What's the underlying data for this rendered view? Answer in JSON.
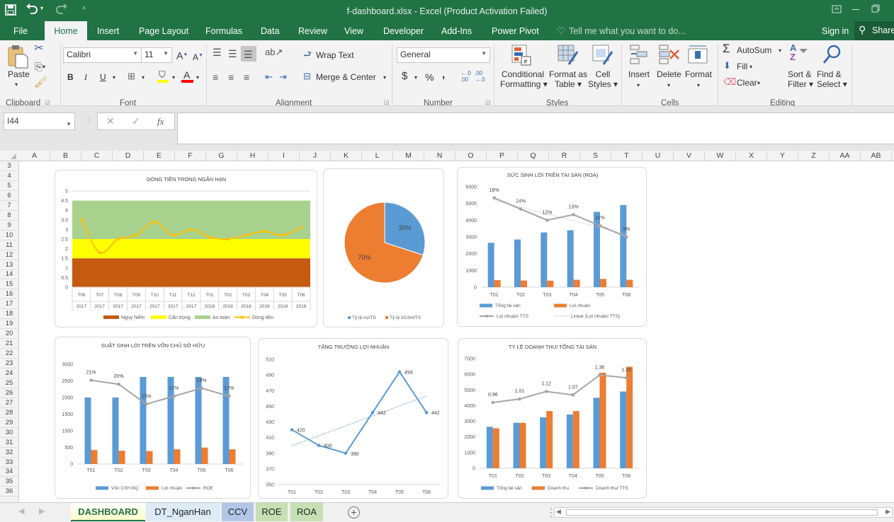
{
  "window": {
    "title": "f-dashboard.xlsx - Excel (Product Activation Failed)"
  },
  "menu_tabs": [
    "File",
    "Home",
    "Insert",
    "Page Layout",
    "Formulas",
    "Data",
    "Review",
    "View",
    "Developer",
    "Add-Ins",
    "Power Pivot"
  ],
  "active_tab": "Home",
  "tell_me": "Tell me what you want to do...",
  "sign_in": "Sign in",
  "share": "Share",
  "ribbon": {
    "clipboard": {
      "label": "Clipboard",
      "paste": "Paste"
    },
    "font": {
      "label": "Font",
      "name": "Calibri",
      "size": "11",
      "bold": "B",
      "italic": "I",
      "underline": "U",
      "fill_color": "#ffff00",
      "font_color": "#ff0000"
    },
    "alignment": {
      "label": "Alignment",
      "wrap": "Wrap Text",
      "merge": "Merge & Center"
    },
    "number": {
      "label": "Number",
      "format": "General",
      "currency": "$",
      "percent": "%",
      "comma": ","
    },
    "styles": {
      "label": "Styles",
      "conditional": [
        "Conditional",
        "Formatting"
      ],
      "format_table": [
        "Format as",
        "Table"
      ],
      "cell_styles": [
        "Cell",
        "Styles"
      ]
    },
    "cells": {
      "label": "Cells",
      "insert": "Insert",
      "delete": "Delete",
      "format": "Format"
    },
    "editing": {
      "label": "Editing",
      "autosum": "AutoSum",
      "fill": "Fill",
      "clear": "Clear",
      "sort": [
        "Sort &",
        "Filter"
      ],
      "find": [
        "Find &",
        "Select"
      ]
    }
  },
  "formula_bar": {
    "name_box": "I44",
    "formula": "",
    "fx": "fx"
  },
  "columns": [
    "A",
    "B",
    "C",
    "D",
    "E",
    "F",
    "G",
    "H",
    "I",
    "J",
    "K",
    "L",
    "M",
    "N",
    "O",
    "P",
    "Q",
    "R",
    "S",
    "T",
    "U",
    "V",
    "W",
    "X",
    "Y",
    "Z",
    "AA",
    "AB"
  ],
  "rows": [
    "3",
    "4",
    "5",
    "6",
    "7",
    "8",
    "9",
    "10",
    "11",
    "12",
    "13",
    "14",
    "15",
    "16",
    "17",
    "18",
    "19",
    "20",
    "21",
    "22",
    "23",
    "24",
    "25",
    "26",
    "27",
    "28",
    "29",
    "30",
    "31",
    "32",
    "33",
    "34",
    "35",
    "36"
  ],
  "sheet_tabs": [
    {
      "name": "DASHBOARD",
      "color": "#ffffcc"
    },
    {
      "name": "DT_NganHan",
      "color": "#ddebf7"
    },
    {
      "name": "CCV",
      "color": "#b4c6e7"
    },
    {
      "name": "ROE",
      "color": "#c6e0b4"
    },
    {
      "name": "ROA",
      "color": "#c6e0b4"
    }
  ],
  "active_sheet": "DASHBOARD",
  "chart_data": [
    {
      "type": "area+line",
      "title": "DÒNG TIỀN TRONG NGẮN HẠN",
      "categories": [
        "T06",
        "T07",
        "T08",
        "T09",
        "T10",
        "T11",
        "T12",
        "T01",
        "T02",
        "T03",
        "T04",
        "T05",
        "T06"
      ],
      "category_years": [
        "2017",
        "2017",
        "2017",
        "2017",
        "2017",
        "2017",
        "2017",
        "2018",
        "2018",
        "2018",
        "2018",
        "2018",
        "2018"
      ],
      "ylim": [
        0,
        5
      ],
      "yticks": [
        "0",
        "0.5",
        "1",
        "1.5",
        "2",
        "2.5",
        "3",
        "3.5",
        "4",
        "4.5",
        "5"
      ],
      "grid": "top line only",
      "stacked_areas": [
        {
          "name": "Nguy hiểm",
          "value": 1.5,
          "color": "#c55a11"
        },
        {
          "name": "Cẩn trọng",
          "value": 1.0,
          "color": "#ffff00"
        },
        {
          "name": "An toàn",
          "value": 2.0,
          "color": "#a9d18e"
        }
      ],
      "series": [
        {
          "name": "Dòng tiền",
          "values": [
            3.5,
            1.8,
            2.5,
            2.7,
            3.4,
            2.7,
            3.0,
            2.6,
            2.5,
            2.7,
            2.9,
            2.7,
            3.1
          ],
          "color": "#ffc000"
        }
      ],
      "legend": "bottom"
    },
    {
      "type": "pie",
      "labels": [
        "Tỷ lệ nợ/TS",
        "Tỷ lệ VCSH/TS"
      ],
      "values": [
        30,
        70
      ],
      "data_labels": [
        "30%",
        "70%"
      ],
      "colors": [
        "#5b9bd5",
        "#ed7d31"
      ],
      "legend": "bottom"
    },
    {
      "type": "bar+line",
      "title": "SỨC SINH LỜI TRÊN TÀI SẢN (ROA)",
      "categories": [
        "T01",
        "T02",
        "T03",
        "T04",
        "T05",
        "T06"
      ],
      "ylim": [
        0,
        6000
      ],
      "yticks": [
        "0",
        "1000",
        "2000",
        "3000",
        "4000",
        "5000",
        "6000"
      ],
      "bars": [
        {
          "name": "Tổng tài sản",
          "values": [
            2650,
            2850,
            3270,
            3400,
            4500,
            4900
          ],
          "color": "#5b9bd5"
        },
        {
          "name": "Lợi nhuận",
          "values": [
            420,
            400,
            390,
            442,
            494,
            442
          ],
          "color": "#ed7d31"
        }
      ],
      "line": {
        "name": "Lợi nhuận/ TTS",
        "values": [
          16,
          14,
          12,
          13,
          11,
          9
        ],
        "labels": [
          "16%",
          "14%",
          "12%",
          "13%",
          "11%",
          "9%"
        ],
        "secondary_ylim": [
          0,
          18
        ],
        "color": "#a5a5a5"
      },
      "trendline": {
        "name": "Linear (Lợi nhuận/ TTS)",
        "type": "linear"
      },
      "legend": "bottom"
    },
    {
      "type": "bar+line",
      "title": "SUẤT SINH LỜI TRÊN VỐN CHỦ SỞ HỮU",
      "categories": [
        "T01",
        "T02",
        "T03",
        "T04",
        "T05",
        "T06"
      ],
      "ylim": [
        0,
        3000
      ],
      "yticks": [
        "0",
        "500",
        "1000",
        "1500",
        "2000",
        "2500",
        "3000"
      ],
      "bars": [
        {
          "name": "Vốn CSH BQ",
          "values": [
            2000,
            2000,
            2620,
            2620,
            2620,
            2620
          ],
          "color": "#5b9bd5"
        },
        {
          "name": "Lợi nhuận",
          "values": [
            420,
            400,
            390,
            442,
            494,
            442
          ],
          "color": "#ed7d31"
        }
      ],
      "line": {
        "name": "ROE",
        "values": [
          21,
          20,
          15,
          17,
          19,
          17
        ],
        "labels": [
          "21%",
          "20%",
          "15%",
          "17%",
          "19%",
          "17%"
        ],
        "secondary_ylim": [
          0,
          25
        ],
        "color": "#a5a5a5"
      },
      "legend": "bottom"
    },
    {
      "type": "line",
      "title": "TĂNG TRƯỞNG LỢI NHUẬN",
      "categories": [
        "T01",
        "T02",
        "T03",
        "T04",
        "T05",
        "T06"
      ],
      "ylim": [
        350,
        510
      ],
      "yticks": [
        "350",
        "370",
        "390",
        "410",
        "430",
        "450",
        "470",
        "490",
        "510"
      ],
      "line": {
        "values": [
          420,
          400,
          390,
          442,
          494,
          442
        ],
        "labels": [
          "420",
          "400",
          "390",
          "442",
          "494",
          "442"
        ],
        "color": "#5b9bd5"
      },
      "trendline": {
        "type": "linear"
      }
    },
    {
      "type": "bar+line",
      "title": "TỶ LỆ DOANH THU/ TỔNG TÀI SẢN",
      "categories": [
        "T01",
        "T02",
        "T03",
        "T04",
        "T05",
        "T06"
      ],
      "ylim": [
        0,
        7000
      ],
      "yticks": [
        "0",
        "1000",
        "2000",
        "3000",
        "4000",
        "5000",
        "6000",
        "7000"
      ],
      "bars": [
        {
          "name": "Tổng tài sản",
          "values": [
            2650,
            2900,
            3250,
            3430,
            4500,
            4900
          ],
          "color": "#5b9bd5"
        },
        {
          "name": "Doanh thu",
          "values": [
            2550,
            2900,
            3650,
            3650,
            6100,
            6480
          ],
          "color": "#ed7d31"
        }
      ],
      "line": {
        "name": "Doanh thu/ TTS",
        "values": [
          0.96,
          1.01,
          1.12,
          1.07,
          1.36,
          1.32
        ],
        "labels": [
          "0.96",
          "1.01",
          "1.12",
          "1.07",
          "1.36",
          "1.32"
        ],
        "secondary_ylim": [
          0,
          1.6
        ],
        "color": "#a5a5a5"
      },
      "legend": "bottom"
    }
  ]
}
